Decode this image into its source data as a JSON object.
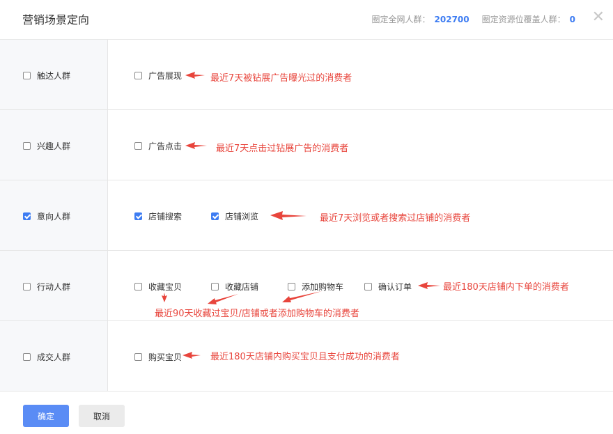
{
  "header": {
    "title": "营销场景定向",
    "total_label": "圈定全网人群：",
    "total_value": "202700",
    "coverage_label": "圈定资源位覆盖人群：",
    "coverage_value": "0",
    "close_icon": "close-icon"
  },
  "rows": [
    {
      "label": "触达人群",
      "checked": false,
      "options": [
        {
          "label": "广告展现",
          "checked": false
        }
      ],
      "note": "最近7天被钻展广告曝光过的消费者"
    },
    {
      "label": "兴趣人群",
      "checked": false,
      "options": [
        {
          "label": "广告点击",
          "checked": false
        }
      ],
      "note": "最近7天点击过钻展广告的消费者"
    },
    {
      "label": "意向人群",
      "checked": true,
      "options": [
        {
          "label": "店铺搜索",
          "checked": true
        },
        {
          "label": "店铺浏览",
          "checked": true
        }
      ],
      "note": "最近7天浏览或者搜索过店铺的消费者"
    },
    {
      "label": "行动人群",
      "checked": false,
      "options": [
        {
          "label": "收藏宝贝",
          "checked": false
        },
        {
          "label": "收藏店铺",
          "checked": false
        },
        {
          "label": "添加购物车",
          "checked": false
        },
        {
          "label": "确认订单",
          "checked": false
        }
      ],
      "note": "最近180天店铺内下单的消费者",
      "note2": "最近90天收藏过宝贝/店铺或者添加购物车的消费者"
    },
    {
      "label": "成交人群",
      "checked": false,
      "options": [
        {
          "label": "购买宝贝",
          "checked": false
        }
      ],
      "note": "最近180天店铺内购买宝贝且支付成功的消费者"
    }
  ],
  "footer": {
    "confirm": "确定",
    "cancel": "取消"
  },
  "colors": {
    "accent": "#3d7cf2",
    "annotation": "#e8453c"
  }
}
